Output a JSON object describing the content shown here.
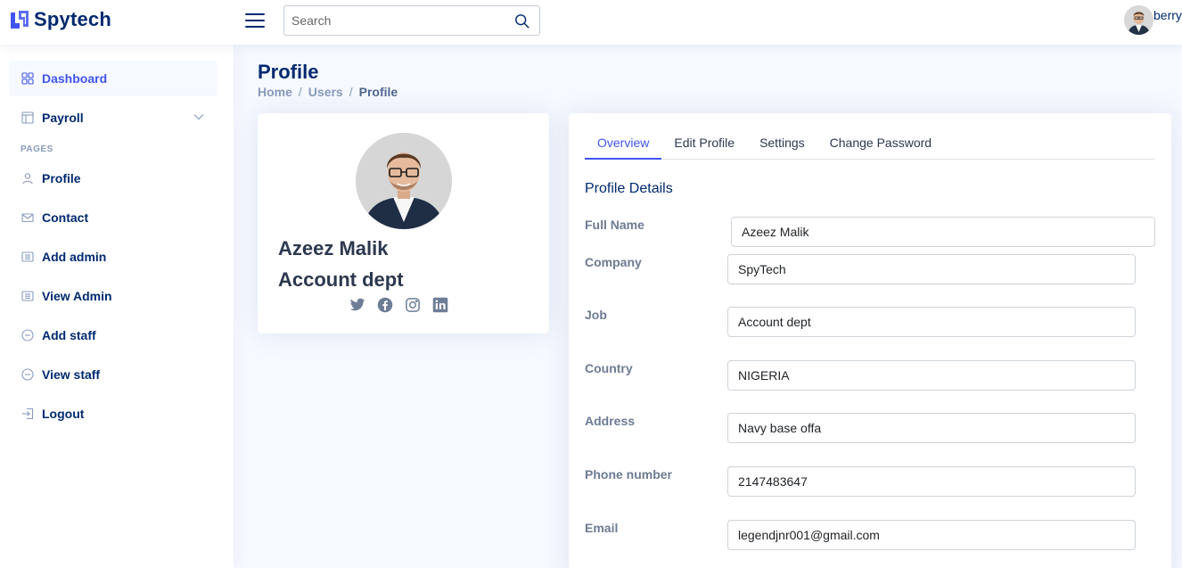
{
  "app": {
    "name": "Spytech"
  },
  "search": {
    "placeholder": "Search"
  },
  "user": {
    "name": "berry"
  },
  "sidebar": {
    "items": [
      {
        "label": "Dashboard",
        "icon": "grid-icon"
      },
      {
        "label": "Payroll",
        "icon": "layout-icon"
      }
    ],
    "pages_heading": "PAGES",
    "pages": [
      {
        "label": "Profile",
        "icon": "person-icon"
      },
      {
        "label": "Contact",
        "icon": "envelope-icon"
      },
      {
        "label": "Add admin",
        "icon": "card-list-icon"
      },
      {
        "label": "View Admin",
        "icon": "card-list-icon"
      },
      {
        "label": "Add staff",
        "icon": "dash-circle-icon"
      },
      {
        "label": "View staff",
        "icon": "dash-circle-icon"
      },
      {
        "label": "Logout",
        "icon": "box-arrow-in-right-icon"
      }
    ]
  },
  "page": {
    "title": "Profile",
    "breadcrumb": [
      "Home",
      "Users",
      "Profile"
    ]
  },
  "profile_card": {
    "name": "Azeez Malik",
    "job": "Account dept",
    "socials": [
      "twitter-icon",
      "facebook-icon",
      "instagram-icon",
      "linkedin-icon"
    ]
  },
  "tabs": [
    "Overview",
    "Edit Profile",
    "Settings",
    "Change Password"
  ],
  "details": {
    "title": "Profile Details",
    "fields": [
      {
        "label": "Full Name",
        "value": "Azeez Malik"
      },
      {
        "label": "Company",
        "value": "SpyTech"
      },
      {
        "label": "Job",
        "value": "Account dept"
      },
      {
        "label": "Country",
        "value": "NIGERIA"
      },
      {
        "label": "Address",
        "value": "Navy base offa"
      },
      {
        "label": "Phone number",
        "value": "2147483647"
      },
      {
        "label": "Email",
        "value": "legendjnr001@gmail.com"
      }
    ]
  },
  "colors": {
    "primary": "#4154f1",
    "navy": "#012970",
    "muted": "#899bbd",
    "background": "#f6f9ff"
  }
}
